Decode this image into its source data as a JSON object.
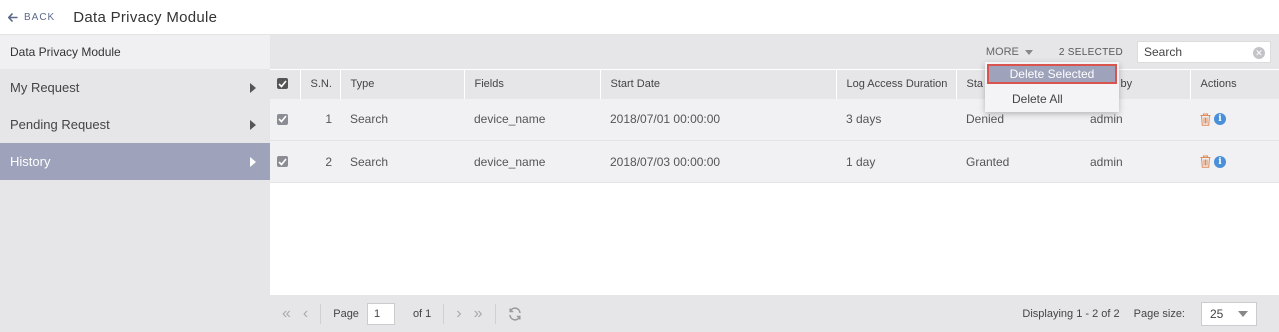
{
  "header": {
    "back_label": "BACK",
    "title": "Data Privacy Module"
  },
  "sidebar": {
    "heading": "Data Privacy Module",
    "items": [
      {
        "label": "My Request"
      },
      {
        "label": "Pending Request"
      },
      {
        "label": "History"
      }
    ]
  },
  "toolbar": {
    "more_label": "MORE",
    "selected_label": "2 SELECTED",
    "search_placeholder": "Search"
  },
  "dropdown": {
    "items": [
      "Delete Selected",
      "Delete All"
    ]
  },
  "table": {
    "columns": [
      "S.N.",
      "Type",
      "Fields",
      "Start Date",
      "Log Access Duration",
      "Sta",
      "ested by",
      "Actions"
    ],
    "rows": [
      {
        "sn": "1",
        "type": "Search",
        "fields": "device_name",
        "start": "2018/07/01 00:00:00",
        "duration": "3 days",
        "status": "Denied",
        "by": "admin"
      },
      {
        "sn": "2",
        "type": "Search",
        "fields": "device_name",
        "start": "2018/07/03 00:00:00",
        "duration": "1 day",
        "status": "Granted",
        "by": "admin"
      }
    ]
  },
  "footer": {
    "page_label": "Page",
    "page_value": "1",
    "of_label": "of 1",
    "displaying": "Displaying 1 - 2 of 2",
    "page_size_label": "Page size:",
    "page_size_value": "25"
  },
  "colors": {
    "sidebar_active": "#9ea2ba",
    "info_icon": "#4a90d9",
    "trash_icon": "#e08a5a",
    "highlight_outline": "#d9534f"
  }
}
